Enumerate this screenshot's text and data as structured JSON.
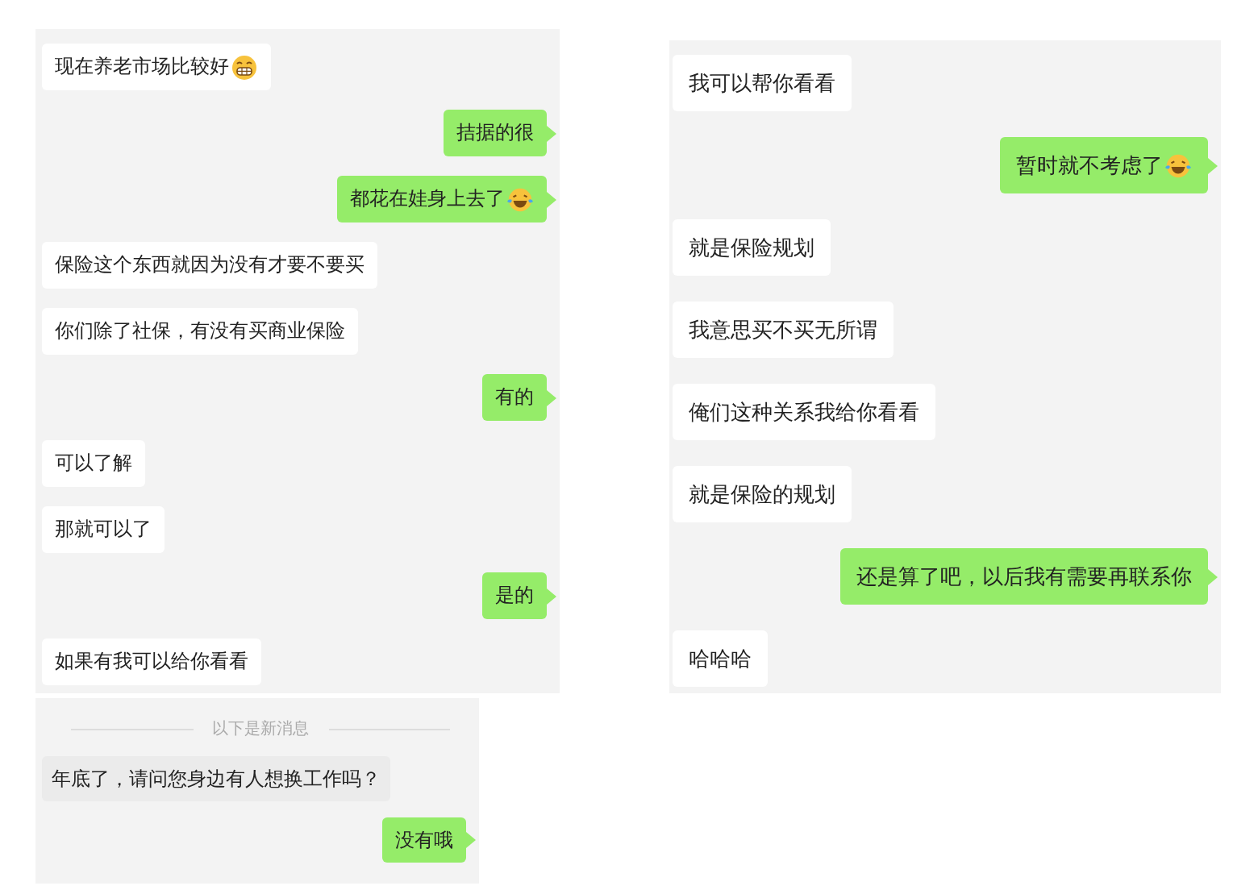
{
  "left_column": {
    "chat": {
      "messages": [
        {
          "kind": "received",
          "text": "现在养老市场比较好",
          "emoji": {
            "kind": "grin"
          }
        },
        {
          "kind": "sent",
          "text": "拮据的很"
        },
        {
          "kind": "sent",
          "text": "都花在娃身上去了",
          "emoji": {
            "kind": "laugh"
          }
        },
        {
          "kind": "received",
          "text": "保险这个东西就因为没有才要不要买"
        },
        {
          "kind": "received",
          "text": "你们除了社保，有没有买商业保险"
        },
        {
          "kind": "sent",
          "text": "有的"
        },
        {
          "kind": "received",
          "text": "可以了解"
        },
        {
          "kind": "received",
          "text": "那就可以了"
        },
        {
          "kind": "sent",
          "text": "是的"
        },
        {
          "kind": "received",
          "text": "如果有我可以给你看看"
        }
      ]
    },
    "new_chat": {
      "messages": [
        {
          "kind": "divider",
          "text": "以下是新消息"
        },
        {
          "kind": "received",
          "text": "年底了，请问您身边有人想换工作吗？"
        },
        {
          "kind": "sent",
          "text": "没有哦"
        }
      ]
    }
  },
  "right_column": {
    "chat": {
      "messages": [
        {
          "kind": "received",
          "text": "我可以帮你看看"
        },
        {
          "kind": "sent",
          "text": "暂时就不考虑了",
          "emoji": {
            "kind": "laugh"
          }
        },
        {
          "kind": "received",
          "text": "就是保险规划"
        },
        {
          "kind": "received",
          "text": "我意思买不买无所谓"
        },
        {
          "kind": "received",
          "text": "俺们这种关系我给你看看"
        },
        {
          "kind": "received",
          "text": "就是保险的规划"
        },
        {
          "kind": "sent",
          "text": "还是算了吧，以后我有需要再联系你"
        },
        {
          "kind": "received",
          "text": "哈哈哈"
        }
      ]
    }
  }
}
